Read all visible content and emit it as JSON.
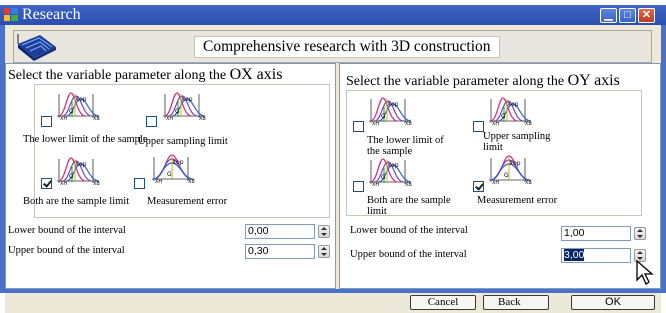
{
  "window": {
    "title": "Research",
    "controls": [
      "minimize",
      "maximize",
      "close"
    ]
  },
  "header": {
    "heading": "Comprehensive research with 3D construction"
  },
  "panel_ox": {
    "title_prefix": "Select the variable parameter along the ",
    "title_axis": "OX axis",
    "options": [
      {
        "label": "The lower limit of the sample",
        "checked": false
      },
      {
        "label": "Upper sampling limit",
        "checked": false
      },
      {
        "label": "Both are the sample limit",
        "checked": true
      },
      {
        "label": "Measurement error",
        "checked": false
      }
    ],
    "lower_label": "Lower bound of the interval",
    "lower_value": "0,00",
    "upper_label": "Upper bound of the interval",
    "upper_value": "0,30"
  },
  "panel_oy": {
    "title_prefix": "Select the variable parameter along the ",
    "title_axis": "OY axis",
    "options": [
      {
        "label": "The lower limit of the sample",
        "checked": false
      },
      {
        "label": "Upper sampling limit",
        "checked": false
      },
      {
        "label": "Both are the sample limit",
        "checked": false
      },
      {
        "label": "Measurement error",
        "checked": true
      }
    ],
    "lower_label": "Lower bound of the interval",
    "lower_value": "1,00",
    "upper_label": "Upper bound of the interval",
    "upper_value": "3,00"
  },
  "buttons": {
    "cancel": "Cancel",
    "back": "Back",
    "ok": "OK"
  },
  "colors": {
    "titlebar": "#2f57b8",
    "face": "#ece9d8",
    "selection": "#0a246a"
  },
  "icons": {
    "cursor": "mouse-pointer-icon",
    "chart": "distribution-curves-icon"
  }
}
